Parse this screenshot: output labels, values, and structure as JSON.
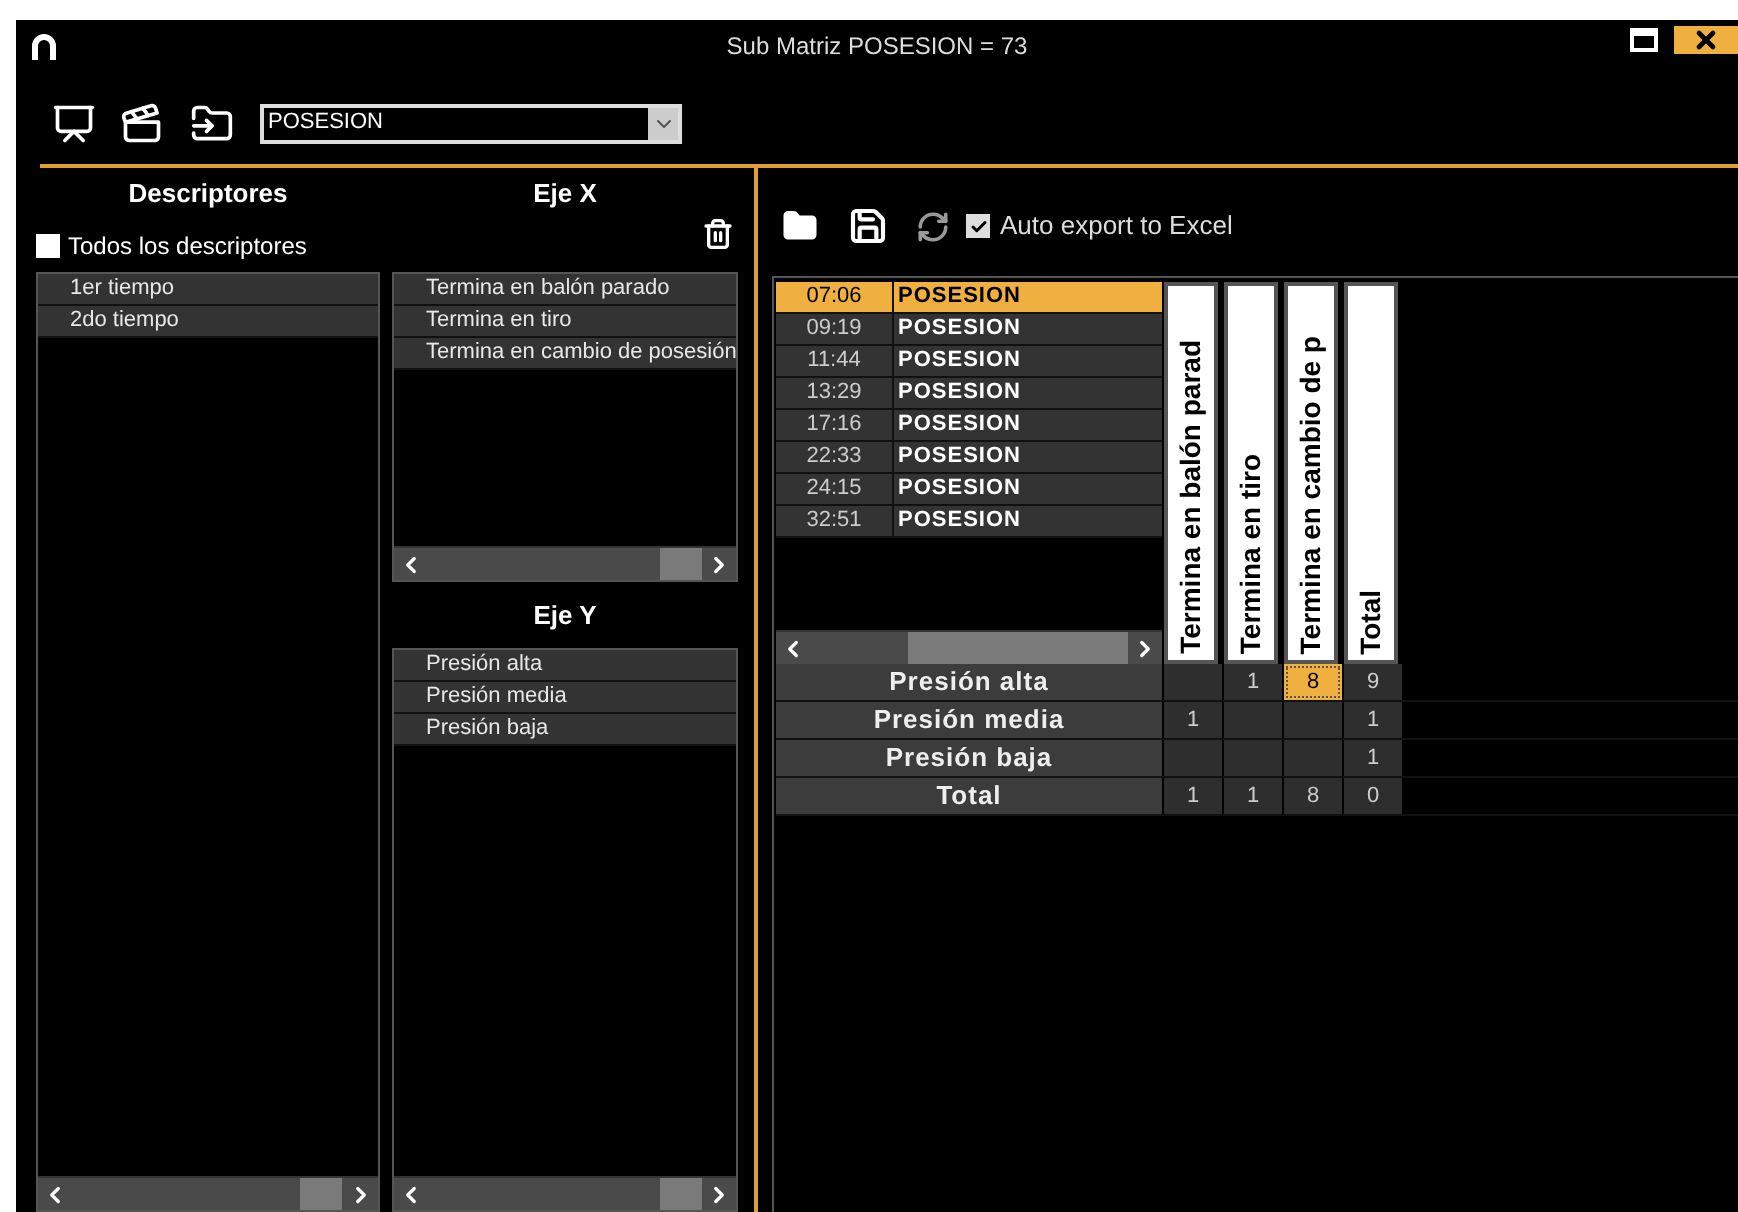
{
  "window": {
    "title": "Sub Matriz POSESION = 73"
  },
  "toolbar": {
    "category_select": {
      "value": "POSESION"
    }
  },
  "descriptors": {
    "title": "Descriptores",
    "select_all": {
      "label": "Todos los descriptores",
      "checked": false
    },
    "items": [
      "1er tiempo",
      "2do tiempo"
    ]
  },
  "axis_x": {
    "title": "Eje X",
    "items": [
      "Termina en balón parado",
      "Termina en tiro",
      "Termina en cambio de posesión"
    ]
  },
  "axis_y": {
    "title": "Eje Y",
    "items": [
      "Presión alta",
      "Presión media",
      "Presión baja"
    ]
  },
  "auto_export": {
    "label": "Auto export to Excel",
    "checked": true
  },
  "events": [
    {
      "time": "07:06",
      "name": "POSESION",
      "selected": true
    },
    {
      "time": "09:19",
      "name": "POSESION",
      "selected": false
    },
    {
      "time": "11:44",
      "name": "POSESION",
      "selected": false
    },
    {
      "time": "13:29",
      "name": "POSESION",
      "selected": false
    },
    {
      "time": "17:16",
      "name": "POSESION",
      "selected": false
    },
    {
      "time": "22:33",
      "name": "POSESION",
      "selected": false
    },
    {
      "time": "24:15",
      "name": "POSESION",
      "selected": false
    },
    {
      "time": "32:51",
      "name": "POSESION",
      "selected": false
    }
  ],
  "matrix": {
    "columns": [
      "Termina en balón parad",
      "Termina en tiro",
      "Termina en cambio de p",
      "Total"
    ],
    "rows": [
      {
        "label": "Presión alta",
        "cells": [
          {
            "selected": false
          },
          {
            "value": "1",
            "selected": false
          },
          {
            "value": "8",
            "selected": true
          },
          {
            "value": "9",
            "selected": false
          }
        ]
      },
      {
        "label": "Presión media",
        "cells": [
          {
            "value": "1",
            "selected": false
          },
          {
            "selected": false
          },
          {
            "selected": false
          },
          {
            "value": "1",
            "selected": false
          }
        ]
      },
      {
        "label": "Presión baja",
        "cells": [
          {
            "selected": false
          },
          {
            "selected": false
          },
          {
            "selected": false
          },
          {
            "value": "1",
            "selected": false
          }
        ]
      },
      {
        "label": "Total",
        "cells": [
          {
            "value": "1",
            "selected": false
          },
          {
            "value": "1",
            "selected": false
          },
          {
            "value": "8",
            "selected": false
          },
          {
            "value": "0",
            "selected": false
          }
        ]
      }
    ]
  }
}
